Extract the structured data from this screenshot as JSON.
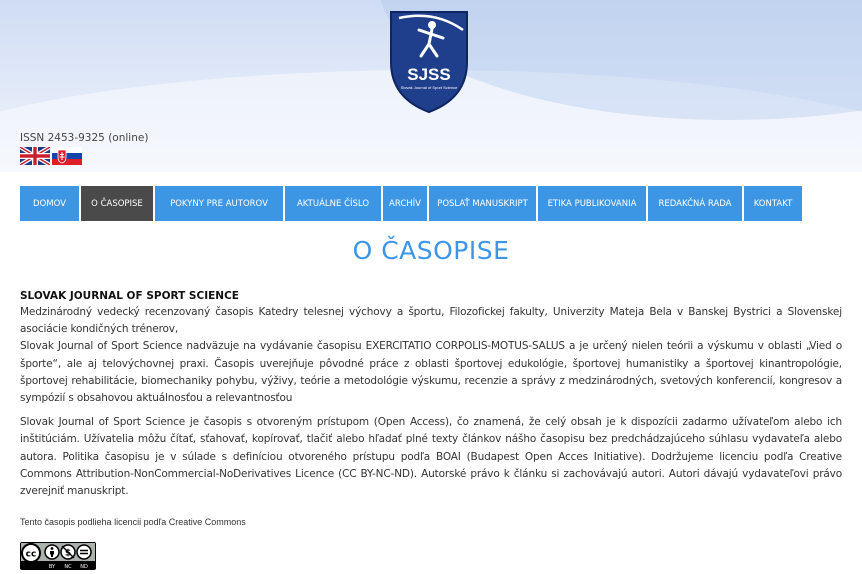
{
  "header": {
    "logo_text": "SJSS",
    "logo_subtext": "Slovak Journal of Sport Science",
    "issn": "ISSN 2453-9325 (online)",
    "flags": [
      {
        "icon": "uk-flag-icon"
      },
      {
        "icon": "slovak-flag-icon"
      }
    ]
  },
  "nav": {
    "items": [
      {
        "label": "DOMOV",
        "active": false
      },
      {
        "label": "O ČASOPISE",
        "active": true
      },
      {
        "label": "POKYNY PRE AUTOROV",
        "active": false
      },
      {
        "label": "AKTUÁLNE ČÍSLO",
        "active": false
      },
      {
        "label": "ARCHÍV",
        "active": false
      },
      {
        "label": "POSLAŤ MANUSKRIPT",
        "active": false
      },
      {
        "label": "ETIKA PUBLIKOVANIA",
        "active": false
      },
      {
        "label": "REDAKČNÁ RADA",
        "active": false
      },
      {
        "label": "KONTAKT",
        "active": false
      }
    ],
    "color": "#3d96e4",
    "active_color": "#4a4a4a"
  },
  "page": {
    "title": "O ČASOPISE",
    "heading": "SLOVAK JOURNAL OF SPORT SCIENCE",
    "paragraphs": [
      "Medzinárodný vedecký recenzovaný časopis Katedry telesnej výchovy a športu, Filozofickej fakulty, Univerzity Mateja Bela v Banskej Bystrici a Slovenskej asociácie kondičných trénerov,",
      "Slovak Journal of Sport Science nadväzuje na vydávanie časopisu EXERCITATIO CORPOLIS-MOTUS-SALUS a je určený nielen teórii a výskumu v oblasti „Vied o športe“, ale aj telovýchovnej praxi. Časopis uverejňuje pôvodné práce z oblasti športovej edukológie, športovej humanistiky a športovej kinantropológie, športovej rehabilitácie, biomechaniky pohybu, výživy,  teórie a metodológie výskumu, recenzie a správy z medzinárodných, svetových konferencií, kongresov a sympózií s obsahovou aktuálnosťou a relevantnosťou",
      "Slovak Journal of Sport Science je časopis s otvoreným prístupom (Open Access), čo znamená, že celý obsah je k dispozícii zadarmo užívateľom alebo ich inštitúciám. Užívatelia môžu čítať, sťahovať, kopírovať, tlačiť alebo hľadať plné texty článkov nášho časopisu bez predchádzajúceho súhlasu vydavateľa alebo autora. Politika časopisu je v súlade s definíciou otvoreného prístupu podľa BOAI (Budapest Open Acces Initiative). Dodržujeme licenciu podľa Creative Commons Attribution-NonCommercial-NoDerivatives Licence (CC BY-NC-ND).  Autorské právo k článku si zachovávajú autori. Autori dávajú vydavateľovi právo zverejniť manuskript."
    ],
    "license_note": "Tento časopis podlieha licencii podľa Creative Commons",
    "cc_badge": {
      "icon": "cc-by-nc-nd-icon",
      "labels": [
        "BY",
        "NC",
        "ND"
      ]
    }
  }
}
